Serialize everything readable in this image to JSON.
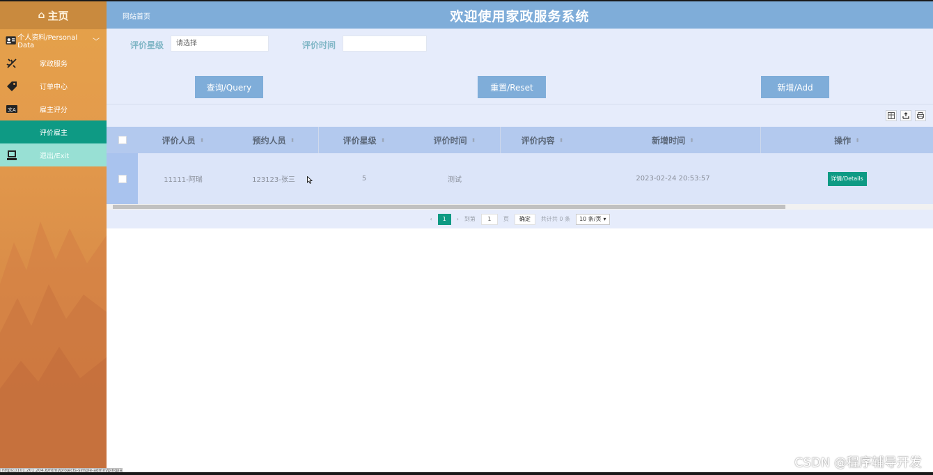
{
  "sidebar": {
    "home_label": "主页",
    "section_label": "个人资料/Personal Data",
    "items": [
      {
        "label": "家政服务",
        "icon": "tools-icon"
      },
      {
        "label": "订单中心",
        "icon": "tag-icon"
      },
      {
        "label": "雇主评分",
        "icon": "translate-icon"
      },
      {
        "label": "评价雇主",
        "icon": ""
      },
      {
        "label": "退出/Exit",
        "icon": "monitor-icon"
      }
    ],
    "active_index": 3
  },
  "header": {
    "breadcrumb": "网站首页",
    "title": "欢迎使用家政服务系统",
    "bg_color": "#7fadd9"
  },
  "search": {
    "rating_label": "评价星级",
    "rating_value": "请选择",
    "time_label": "评价时间",
    "time_value": "",
    "query_button": "查询/Query",
    "reset_button": "重置/Reset",
    "add_button": "新增/Add"
  },
  "table": {
    "columns": [
      "评价人员",
      "预约人员",
      "评价星级",
      "评价时间",
      "评价内容",
      "新增时间",
      "操作"
    ],
    "rows": [
      {
        "reviewer": "11111-阿瑞",
        "appointee": "123123-张三",
        "rating": "5",
        "review_time": "测试",
        "content": "",
        "created_at": "2023-02-24 20:53:57",
        "action": "详情/Details"
      }
    ]
  },
  "pager": {
    "prev": "‹",
    "current_page": "1",
    "next": "›",
    "goto_label": "到第",
    "goto_value": "1",
    "page_unit": "页",
    "confirm": "确定",
    "total": "共计共 0 条",
    "page_size": "10 条/页"
  },
  "status_url": "https://101.201.204.8/html/projects-simple-admin/pingjia.html",
  "watermark": "CSDN @程序辅导开发",
  "colors": {
    "accent_teal": "#0e9a84",
    "sidebar_orange": "#e39a4c",
    "panel_bg": "#e6ecfb"
  }
}
